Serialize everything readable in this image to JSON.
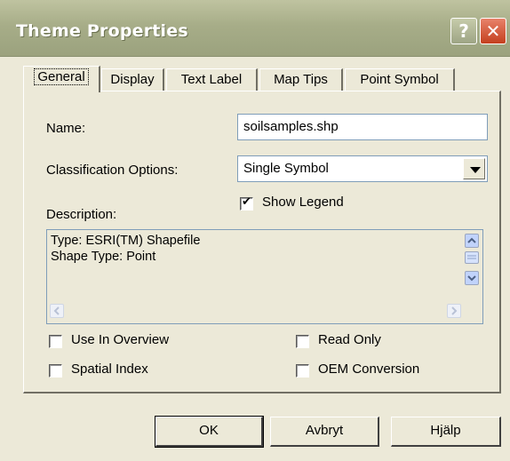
{
  "window": {
    "title": "Theme Properties",
    "help_glyph": "?",
    "close_glyph": "✕"
  },
  "tabs": [
    {
      "label": "General",
      "active": true
    },
    {
      "label": "Display"
    },
    {
      "label": "Text Label"
    },
    {
      "label": "Map Tips"
    },
    {
      "label": "Point Symbol"
    }
  ],
  "general": {
    "name_label": "Name:",
    "name_value": "soilsamples.shp",
    "classification_label": "Classification Options:",
    "classification_value": "Single Symbol",
    "show_legend_label": "Show Legend",
    "show_legend_checked": true,
    "description_label": "Description:",
    "description_lines": [
      "Type: ESRI(TM) Shapefile",
      "Shape Type: Point"
    ],
    "checkboxes": {
      "use_in_overview": "Use In Overview",
      "read_only": "Read Only",
      "spatial_index": "Spatial Index",
      "oem_conversion": "OEM Conversion"
    }
  },
  "buttons": {
    "ok": "OK",
    "cancel": "Avbryt",
    "help": "Hjälp"
  },
  "colors": {
    "titlebar": "#a7ad88",
    "dialog_bg": "#ece9d8",
    "close_button": "#c4401f",
    "scroll_button": "#c1d3fb"
  },
  "icons": [
    "help-icon",
    "close-icon",
    "chevron-down-icon",
    "scroll-up-icon",
    "scroll-down-icon",
    "scroll-left-icon",
    "scroll-right-icon",
    "check-icon"
  ]
}
